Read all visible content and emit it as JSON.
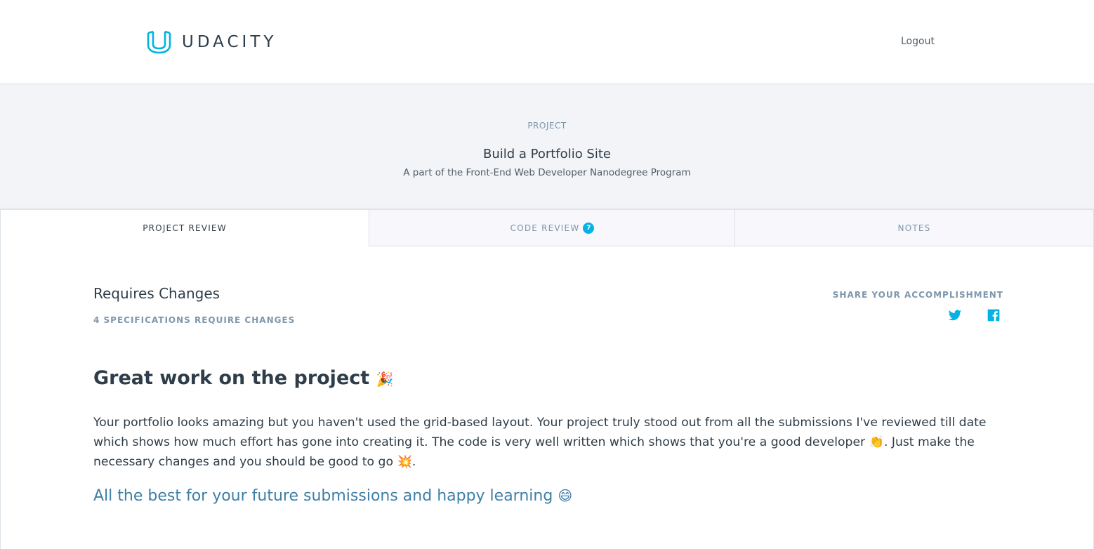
{
  "header": {
    "brand": "UDACITY",
    "logout_label": "Logout"
  },
  "banner": {
    "eyebrow": "PROJECT",
    "title": "Build a Portfolio Site",
    "subtitle": "A part of the Front-End Web Developer Nanodegree Program"
  },
  "tabs": [
    {
      "label": "PROJECT REVIEW",
      "active": true
    },
    {
      "label": "CODE REVIEW",
      "badge": "7",
      "active": false
    },
    {
      "label": "NOTES",
      "active": false
    }
  ],
  "review": {
    "status": "Requires Changes",
    "status_detail": "4 SPECIFICATIONS REQUIRE CHANGES",
    "share_label": "SHARE YOUR ACCOMPLISHMENT",
    "share_icons": [
      "twitter-icon",
      "facebook-icon"
    ],
    "heading": "Great work on the project",
    "heading_emoji": "🎉",
    "body_part1": "Your portfolio looks amazing but you haven't used the grid-based layout. Your project truly stood out from all the submissions I've reviewed till date which shows how much effort has gone into creating it. The code is very well written which shows that you're a good developer ",
    "body_emoji1": "👏",
    "body_part2": ". Just make the necessary changes and you should be good to go ",
    "body_emoji2": "💥",
    "body_part3": ".",
    "closing": "All the best for your future submissions and happy learning",
    "closing_emoji": "😄"
  },
  "colors": {
    "accent": "#02b3e4",
    "text": "#2e3d49",
    "muted": "#7d97ad",
    "closing": "#3e7fa6"
  }
}
